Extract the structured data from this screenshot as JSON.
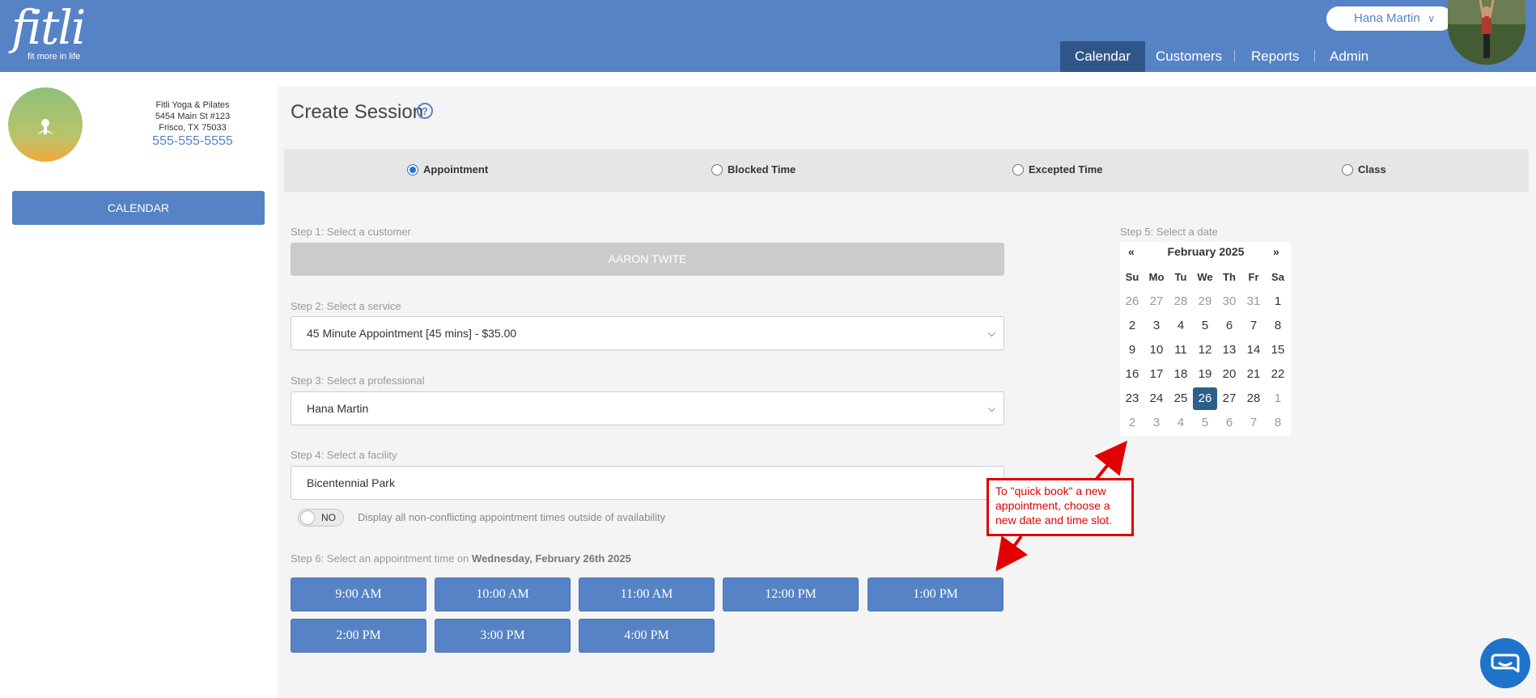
{
  "header": {
    "logo_word": "fitli",
    "logo_tagline": "fit more in life",
    "user_name": "Hana Martin",
    "nav": [
      "Calendar",
      "Customers",
      "Reports",
      "Admin"
    ]
  },
  "sidebar": {
    "business_name": "Fitli Yoga & Pilates",
    "address_line1": "5454 Main St #123",
    "address_line2": "Frisco, TX 75033",
    "phone": "555-555-5555",
    "calendar_button": "CALENDAR"
  },
  "page": {
    "title": "Create Session",
    "types": [
      {
        "label": "Appointment",
        "checked": true
      },
      {
        "label": "Blocked Time",
        "checked": false
      },
      {
        "label": "Excepted Time",
        "checked": false
      },
      {
        "label": "Class",
        "checked": false
      }
    ]
  },
  "form": {
    "step1_label": "Step 1: Select a customer",
    "customer_value": "AARON TWITE",
    "step2_label": "Step 2: Select a service",
    "service_value": "45 Minute Appointment [45 mins] - $35.00",
    "step3_label": "Step 3: Select a professional",
    "professional_value": "Hana Martin",
    "step4_label": "Step 4: Select a facility",
    "facility_value": "Bicentennial Park",
    "toggle_state": "NO",
    "toggle_label": "Display all non-conflicting appointment times outside of availability",
    "step6_label": "Step 6: Select an appointment time on",
    "step6_date": "Wednesday, February 26th 2025",
    "times": [
      "9:00 AM",
      "10:00 AM",
      "11:00 AM",
      "12:00 PM",
      "1:00 PM",
      "2:00 PM",
      "3:00 PM",
      "4:00 PM"
    ]
  },
  "calendar": {
    "step5_label": "Step 5: Select a date",
    "prev": "«",
    "next": "»",
    "month": "February 2025",
    "dow": [
      "Su",
      "Mo",
      "Tu",
      "We",
      "Th",
      "Fr",
      "Sa"
    ],
    "weeks": [
      [
        "26",
        "27",
        "28",
        "29",
        "30",
        "31",
        "1"
      ],
      [
        "2",
        "3",
        "4",
        "5",
        "6",
        "7",
        "8"
      ],
      [
        "9",
        "10",
        "11",
        "12",
        "13",
        "14",
        "15"
      ],
      [
        "16",
        "17",
        "18",
        "19",
        "20",
        "21",
        "22"
      ],
      [
        "23",
        "24",
        "25",
        "26",
        "27",
        "28",
        "1"
      ],
      [
        "2",
        "3",
        "4",
        "5",
        "6",
        "7",
        "8"
      ]
    ],
    "selected_day": "26"
  },
  "annotation": {
    "text": "To \"quick book\" a new appointment, choose a new date and time slot."
  },
  "colors": {
    "brand_blue": "#5683c5",
    "nav_active": "#2f5688",
    "selected_day": "#2c5f8a",
    "annotation_red": "#e00000"
  }
}
